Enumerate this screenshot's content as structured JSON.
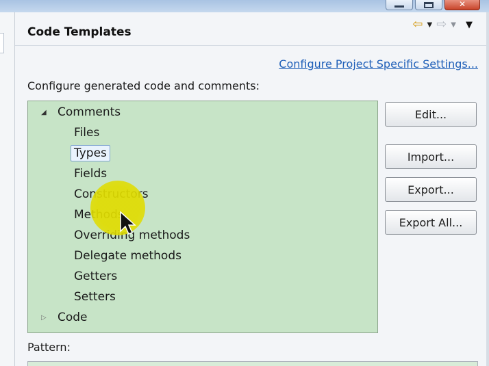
{
  "window": {
    "close_glyph": "✕"
  },
  "header": {
    "title": "Code Templates",
    "back_icon": "back-arrow-icon",
    "forward_icon": "forward-arrow-icon"
  },
  "link": "Configure Project Specific Settings...",
  "description": "Configure generated code and comments:",
  "tree": {
    "root": {
      "label": "Comments",
      "expanded": true
    },
    "children": [
      "Files",
      "Types",
      "Fields",
      "Constructors",
      "Methods",
      "Overriding methods",
      "Delegate methods",
      "Getters",
      "Setters"
    ],
    "selected": "Types",
    "collapsed_root": {
      "label": "Code",
      "expanded": false
    },
    "background_color": "#c7e4c7"
  },
  "buttons": {
    "edit": "Edit...",
    "import": "Import...",
    "export": "Export...",
    "export_all": "Export All..."
  },
  "pattern": {
    "label": "Pattern:"
  }
}
